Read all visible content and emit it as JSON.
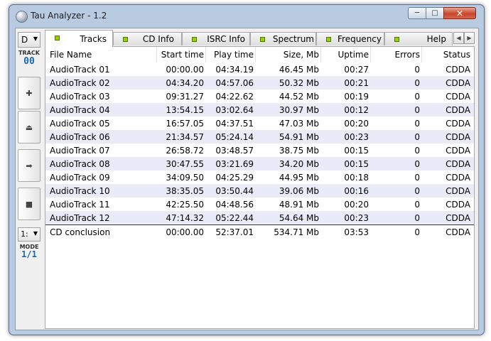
{
  "window": {
    "title": "Tau Analyzer - 1.2",
    "buttons": {
      "minimize": "─",
      "maximize": "□",
      "close": "✕"
    }
  },
  "toolbar": {
    "drive_value": "D",
    "track_label": "TRACK",
    "track_number": "00",
    "buttons": [
      {
        "name": "add",
        "glyph": "✚"
      },
      {
        "name": "eject",
        "glyph": "⏏"
      },
      {
        "name": "next",
        "glyph": "➡"
      },
      {
        "name": "stop",
        "glyph": "■"
      }
    ],
    "mode_value": "1:",
    "mode_label": "MODE",
    "mode_fraction": "1/1"
  },
  "tabs": [
    {
      "label": "Tracks",
      "active": true
    },
    {
      "label": "CD Info"
    },
    {
      "label": "ISRC Info"
    },
    {
      "label": "Spectrum"
    },
    {
      "label": "Frequency"
    },
    {
      "label": "Help"
    }
  ],
  "tab_scroll": {
    "left": "◀",
    "right": "▶"
  },
  "table": {
    "columns": [
      "File Name",
      "Start time",
      "Play time",
      "Size, Mb",
      "Uptime",
      "Errors",
      "Status"
    ],
    "rows": [
      [
        "AudioTrack 01",
        "00:00.00",
        "04:34.19",
        "46.45 Mb",
        "00:27",
        "0",
        "CDDA"
      ],
      [
        "AudioTrack 02",
        "04:34.20",
        "04:57.06",
        "50.32 Mb",
        "00:21",
        "0",
        "CDDA"
      ],
      [
        "AudioTrack 03",
        "09:31.27",
        "04:22.62",
        "44.52 Mb",
        "00:19",
        "0",
        "CDDA"
      ],
      [
        "AudioTrack 04",
        "13:54.15",
        "03:02.64",
        "30.97 Mb",
        "00:12",
        "0",
        "CDDA"
      ],
      [
        "AudioTrack 05",
        "16:57.05",
        "04:37.51",
        "47.03 Mb",
        "00:20",
        "0",
        "CDDA"
      ],
      [
        "AudioTrack 06",
        "21:34.57",
        "05:24.14",
        "54.91 Mb",
        "00:23",
        "0",
        "CDDA"
      ],
      [
        "AudioTrack 07",
        "26:58.72",
        "03:48.57",
        "38.75 Mb",
        "00:15",
        "0",
        "CDDA"
      ],
      [
        "AudioTrack 08",
        "30:47.55",
        "03:21.69",
        "34.20 Mb",
        "00:15",
        "0",
        "CDDA"
      ],
      [
        "AudioTrack 09",
        "34:09.50",
        "04:25.29",
        "44.95 Mb",
        "00:18",
        "0",
        "CDDA"
      ],
      [
        "AudioTrack 10",
        "38:35.05",
        "03:50.44",
        "39.06 Mb",
        "00:16",
        "0",
        "CDDA"
      ],
      [
        "AudioTrack 11",
        "42:25.50",
        "04:48.56",
        "48.91 Mb",
        "00:20",
        "0",
        "CDDA"
      ],
      [
        "AudioTrack 12",
        "47:14.32",
        "05:22.44",
        "54.64 Mb",
        "00:23",
        "0",
        "CDDA"
      ]
    ],
    "summary": [
      "CD conclusion",
      "00:00.00",
      "52:37.01",
      "534.71 Mb",
      "03:53",
      "0",
      "CDDA"
    ]
  },
  "colors": {
    "frame": "#b9cbe0",
    "alt_row": "#e9ebf8",
    "accent_blue": "#1766b0",
    "tab_led": "#9ad000",
    "close_button": "#c9452b"
  }
}
